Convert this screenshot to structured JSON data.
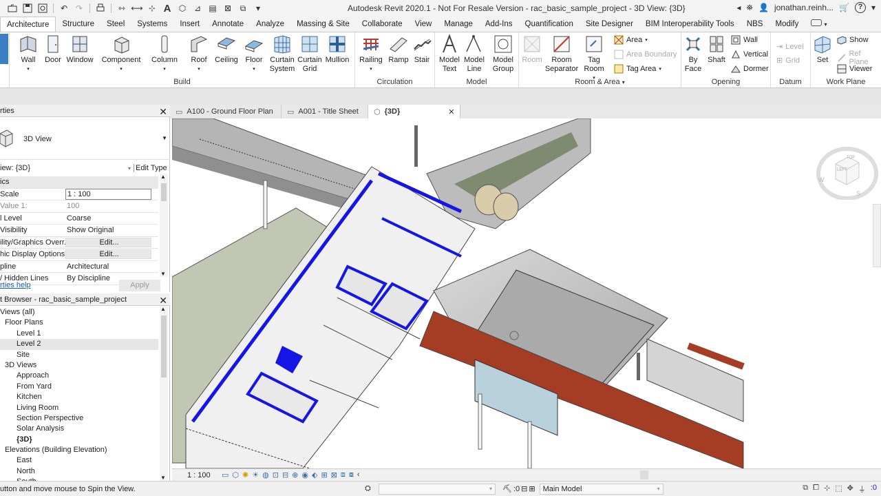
{
  "titlebar": {
    "title": "Autodesk Revit 2020.1 - Not For Resale Version - rac_basic_sample_project - 3D View: {3D}",
    "user": "jonathan.reinh..."
  },
  "ribbon_tabs": [
    "Architecture",
    "Structure",
    "Steel",
    "Systems",
    "Insert",
    "Annotate",
    "Analyze",
    "Massing & Site",
    "Collaborate",
    "View",
    "Manage",
    "Add-Ins",
    "Quantification",
    "Site Designer",
    "BIM Interoperability Tools",
    "NBS",
    "Modify"
  ],
  "ribbon": {
    "modify_label": "ify",
    "build": {
      "title": "Build",
      "buttons": [
        "Wall",
        "Door",
        "Window",
        "Component",
        "Column",
        "Roof",
        "Ceiling",
        "Floor",
        "Curtain\nSystem",
        "Curtain\nGrid",
        "Mullion"
      ]
    },
    "circulation": {
      "title": "Circulation",
      "buttons": [
        "Railing",
        "Ramp",
        "Stair"
      ]
    },
    "model": {
      "title": "Model",
      "buttons": [
        "Model\nText",
        "Model\nLine",
        "Model\nGroup"
      ]
    },
    "room_area": {
      "title": "Room & Area",
      "buttons": [
        "Room",
        "Room\nSeparator",
        "Tag\nRoom"
      ],
      "small": [
        "Area",
        "Area Boundary",
        "Tag Area"
      ]
    },
    "opening": {
      "title": "Opening",
      "buttons": [
        "By\nFace",
        "Shaft"
      ],
      "small": [
        "Wall",
        "Vertical",
        "Dormer"
      ]
    },
    "datum": {
      "title": "Datum",
      "small": [
        "Level",
        "Grid"
      ]
    },
    "work_plane": {
      "title": "Work Plane",
      "buttons": [
        "Set"
      ],
      "small": [
        "Show",
        "Ref Plane",
        "Viewer"
      ]
    }
  },
  "properties": {
    "title": "rties",
    "type_name": "3D View",
    "view_filter": "iew: {3D}",
    "edit_type": "Edit Type",
    "rows": [
      {
        "k": "ics",
        "v": "",
        "cat": true
      },
      {
        "k": "Scale",
        "v": "1 : 100",
        "box": true
      },
      {
        "k": "Value 1:",
        "v": "100",
        "dim": true
      },
      {
        "k": "l Level",
        "v": "Coarse"
      },
      {
        "k": "Visibility",
        "v": "Show Original"
      },
      {
        "k": "ility/Graphics Overr...",
        "v": "Edit...",
        "btn": true
      },
      {
        "k": "hic Display Options",
        "v": "Edit...",
        "btn": true
      },
      {
        "k": "pline",
        "v": "Architectural"
      },
      {
        "k": "/ Hidden Lines",
        "v": "By Discipline"
      }
    ],
    "help_link": "rties help",
    "apply": "Apply"
  },
  "browser": {
    "title": "t Browser - rac_basic_sample_project",
    "tree": [
      {
        "label": "Views (all)",
        "lvl": 0
      },
      {
        "label": "Floor Plans",
        "lvl": 1
      },
      {
        "label": "Level 1",
        "lvl": 2
      },
      {
        "label": "Level 2",
        "lvl": 2,
        "sel": true
      },
      {
        "label": "Site",
        "lvl": 2
      },
      {
        "label": "3D Views",
        "lvl": 1
      },
      {
        "label": "Approach",
        "lvl": 2
      },
      {
        "label": "From Yard",
        "lvl": 2
      },
      {
        "label": "Kitchen",
        "lvl": 2
      },
      {
        "label": "Living Room",
        "lvl": 2
      },
      {
        "label": "Section Perspective",
        "lvl": 2
      },
      {
        "label": "Solar Analysis",
        "lvl": 2
      },
      {
        "label": "{3D}",
        "lvl": 2,
        "bold": true
      },
      {
        "label": "Elevations (Building Elevation)",
        "lvl": 1
      },
      {
        "label": "East",
        "lvl": 2
      },
      {
        "label": "North",
        "lvl": 2
      },
      {
        "label": "South",
        "lvl": 2
      }
    ]
  },
  "doc_tabs": [
    {
      "label": "A100 - Ground Floor Plan"
    },
    {
      "label": "A001 - Title Sheet"
    },
    {
      "label": "{3D}",
      "active": true
    }
  ],
  "viewcube": {
    "top": "TOP",
    "left": "LEFT",
    "w": "W",
    "s": "S"
  },
  "view_control": {
    "scale": "1 : 100"
  },
  "status": {
    "message": "utton and move mouse to Spin the View.",
    "workset": "Main Model",
    "count": ":0"
  }
}
